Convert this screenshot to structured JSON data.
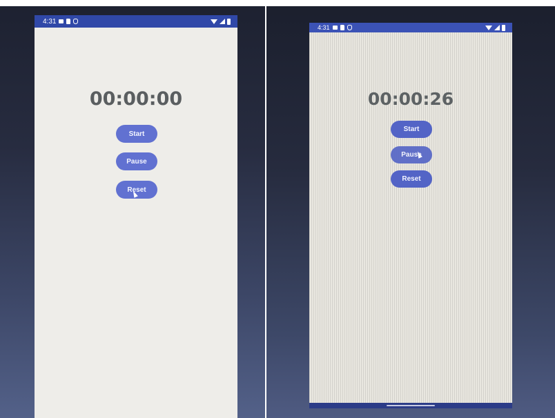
{
  "screens": [
    {
      "status": {
        "time": "4:31"
      },
      "timer": "00:00:00",
      "buttons": {
        "start": "Start",
        "pause": "Pause",
        "reset": "Reset"
      }
    },
    {
      "status": {
        "time": "4:31"
      },
      "timer": "00:00:26",
      "buttons": {
        "start": "Start",
        "pause": "Pause",
        "reset": "Reset"
      }
    }
  ],
  "colors": {
    "status_bar": "#3048a8",
    "button": "#6171d1",
    "timer_text": "#5a5e60",
    "screen_background": "#eeede9"
  }
}
